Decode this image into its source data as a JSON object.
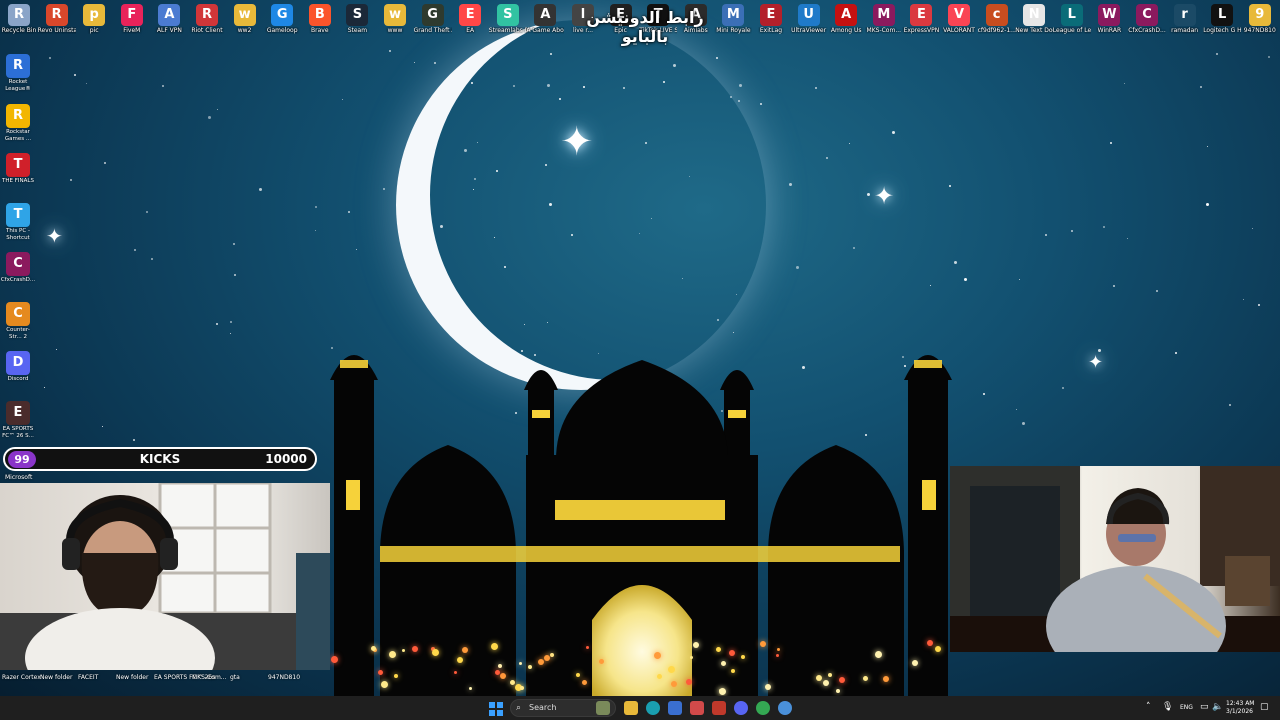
{
  "desktop_icons_top": [
    {
      "label": "Recycle Bin",
      "icon": "recycle-bin-icon",
      "color": "#8aa4c8"
    },
    {
      "label": "Revo Uninstaller",
      "icon": "revo-icon",
      "color": "#d9472b"
    },
    {
      "label": "pic",
      "icon": "folder-icon",
      "color": "#e8b93a"
    },
    {
      "label": "FiveM",
      "icon": "fivem-icon",
      "color": "#e8235a"
    },
    {
      "label": "ALF VPN",
      "icon": "vpn-icon",
      "color": "#4b7bd1"
    },
    {
      "label": "Riot Client",
      "icon": "riot-icon",
      "color": "#d13639"
    },
    {
      "label": "ww2",
      "icon": "folder-icon",
      "color": "#e8b93a"
    },
    {
      "label": "Gameloop",
      "icon": "gameloop-icon",
      "color": "#1e88e5"
    },
    {
      "label": "Brave",
      "icon": "brave-icon",
      "color": "#fb542b"
    },
    {
      "label": "Steam",
      "icon": "steam-icon",
      "color": "#1b2838"
    },
    {
      "label": "www",
      "icon": "folder-icon",
      "color": "#e8b93a"
    },
    {
      "label": "Grand Theft Auto V",
      "icon": "gta-icon",
      "color": "#2e3a2e"
    },
    {
      "label": "EA",
      "icon": "ea-icon",
      "color": "#ff4747"
    },
    {
      "label": "Streamlabs Desktop",
      "icon": "streamlabs-icon",
      "color": "#31c3a2"
    },
    {
      "label": "A Game About D...",
      "icon": "game-icon",
      "color": "#333333"
    },
    {
      "label": "live r...",
      "icon": "live-icon",
      "color": "#444444"
    },
    {
      "label": "Epic",
      "icon": "epic-icon",
      "color": "#202020"
    },
    {
      "label": "TikTok LIVE Studio",
      "icon": "tiktok-icon",
      "color": "#111111"
    },
    {
      "label": "Aimlabs",
      "icon": "aimlabs-icon",
      "color": "#2b2b2b"
    },
    {
      "label": "Mini Royale",
      "icon": "royale-icon",
      "color": "#3b6fb6"
    },
    {
      "label": "ExitLag",
      "icon": "exitlag-icon",
      "color": "#b3202a"
    },
    {
      "label": "UltraViewer",
      "icon": "ultraviewer-icon",
      "color": "#1f7ac9"
    },
    {
      "label": "Among Us",
      "icon": "amongus-icon",
      "color": "#c51111"
    },
    {
      "label": "MKS-Com...",
      "icon": "winrar-icon",
      "color": "#8b1a5e"
    },
    {
      "label": "ExpressVPN",
      "icon": "expressvpn-icon",
      "color": "#da3940"
    },
    {
      "label": "VALORANT",
      "icon": "valorant-icon",
      "color": "#fa4454"
    },
    {
      "label": "cf9df962-1...",
      "icon": "file-icon",
      "color": "#c84d1f"
    },
    {
      "label": "New Text Document",
      "icon": "text-file-icon",
      "color": "#e6e6e6"
    },
    {
      "label": "League of Legends",
      "icon": "lol-icon",
      "color": "#0a6c78"
    },
    {
      "label": "WinRAR",
      "icon": "winrar-icon",
      "color": "#8b1a5e"
    },
    {
      "label": "CfxCrashD...",
      "icon": "winrar-icon",
      "color": "#8b1a5e"
    },
    {
      "label": "ramadan",
      "icon": "image-icon",
      "color": "#1b4a66"
    },
    {
      "label": "Logitech G HUB",
      "icon": "logitech-icon",
      "color": "#111111"
    },
    {
      "label": "947ND810",
      "icon": "folder-icon",
      "color": "#e8b93a"
    }
  ],
  "desktop_icons_left": [
    {
      "label": "Rocket League®",
      "icon": "rocket-league-icon",
      "color": "#2c6fd6"
    },
    {
      "label": "Rockstar Games ...",
      "icon": "rockstar-icon",
      "color": "#f2b600"
    },
    {
      "label": "THE FINALS",
      "icon": "finals-icon",
      "color": "#d0202a"
    },
    {
      "label": "This PC - Shortcut",
      "icon": "this-pc-icon",
      "color": "#2fa4e7"
    },
    {
      "label": "CfxCrashD...",
      "icon": "winrar-icon",
      "color": "#8b1a5e"
    },
    {
      "label": "Counter-Str... 2",
      "icon": "cs2-icon",
      "color": "#e58a1f"
    },
    {
      "label": "Discord",
      "icon": "discord-icon",
      "color": "#5865f2"
    },
    {
      "label": "EA SPORTS FC™ 26 S...",
      "icon": "fc26-icon",
      "color": "#4a2c2c"
    }
  ],
  "overlay": {
    "arabic_text": "رابط الدونيشن بالبايو"
  },
  "kicks_widget": {
    "count": "99",
    "label": "KICKS",
    "goal": "10000",
    "sub_label": "Microsoft"
  },
  "bottom_left_labels": [
    "Razer Cortex",
    "New folder",
    "FACEIT",
    "New folder",
    "EA SPORTS FC™ 26s",
    "MKS-Com...",
    "gta",
    "947ND810"
  ],
  "taskbar": {
    "search_placeholder": "Search",
    "apps": [
      "start-icon",
      "search-icon",
      "widgets-icon",
      "file-explorer-icon",
      "edge-icon",
      "store-icon",
      "mail-icon",
      "taskbar-app-icon",
      "discord-icon",
      "chrome-icon"
    ],
    "language": "ENG",
    "time": "12:43 AM",
    "date": "3/1/2026"
  },
  "colors": {
    "sky_center": "#1f6a88",
    "sky_edge": "#061e30",
    "moon": "#f4f8fb",
    "mosque": "#050505",
    "window_glow": "#f6d23a",
    "taskbar": "#1f1f1f",
    "kicks_badge": "#8a35c9"
  }
}
